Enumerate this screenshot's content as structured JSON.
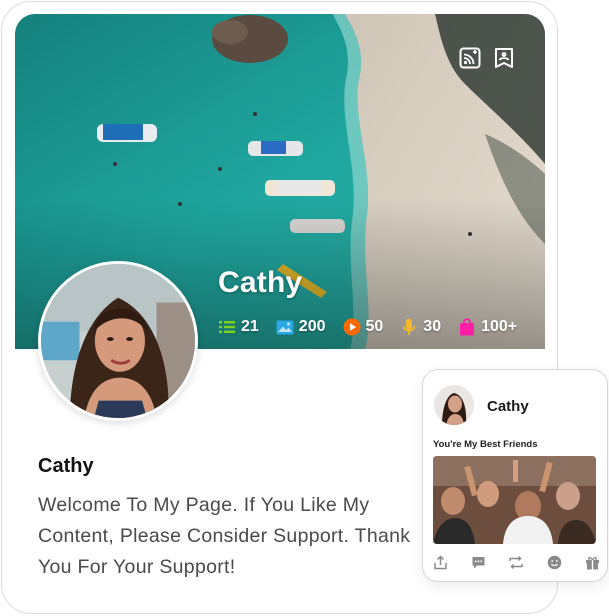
{
  "profile": {
    "name": "Cathy",
    "bio_name": "Cathy",
    "bio": "Welcome To My Page. If You Like My Content, Please Consider Support. Thank You For Your Support!"
  },
  "stats": [
    {
      "icon": "list-icon",
      "value": "21",
      "color": "#7ed321"
    },
    {
      "icon": "image-icon",
      "value": "200",
      "color": "#2aa7e6"
    },
    {
      "icon": "play-icon",
      "value": "50",
      "color": "#ff6a00"
    },
    {
      "icon": "microphone-icon",
      "value": "30",
      "color": "#f5b82e"
    },
    {
      "icon": "gift-bag-icon",
      "value": "100+",
      "color": "#ff1fa7"
    }
  ],
  "cover_actions": [
    {
      "icon": "rss-add-icon"
    },
    {
      "icon": "contact-card-icon"
    }
  ],
  "mini_card": {
    "name": "Cathy",
    "caption": "You're My Best Friends",
    "actions": [
      "share-icon",
      "comment-icon",
      "repost-icon",
      "emoji-icon",
      "gift-icon"
    ]
  },
  "colors": {
    "sea": "#1e9e9a",
    "sand": "#d9cfc2",
    "text_dark": "#111111",
    "text_muted": "#4a4a4a"
  }
}
